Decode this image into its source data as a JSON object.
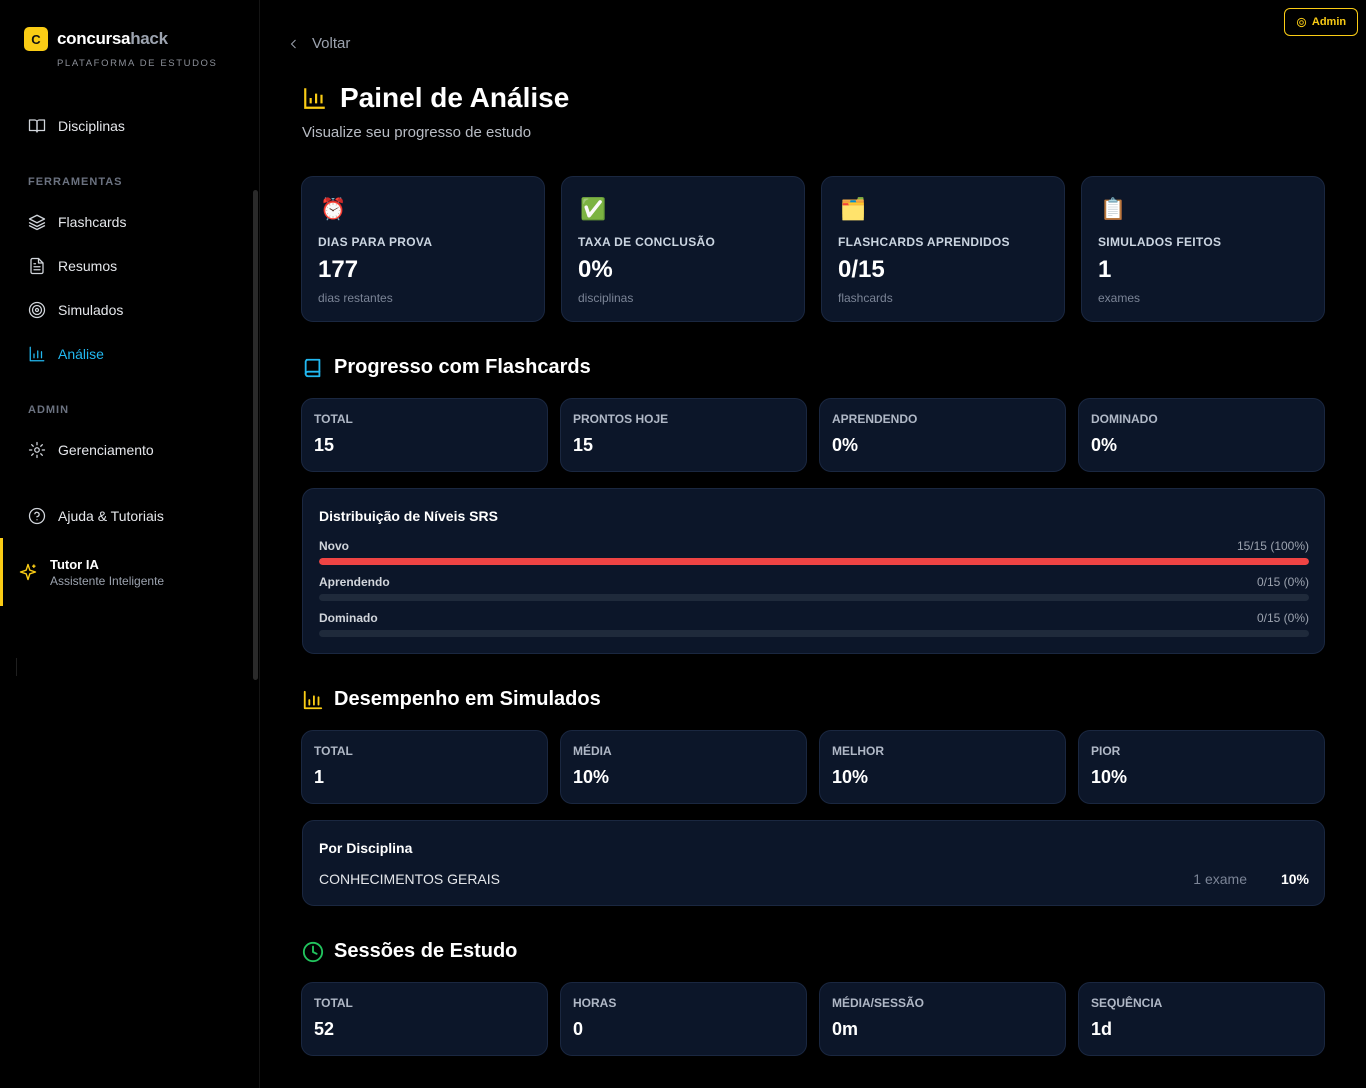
{
  "sidebar": {
    "logo_badge": "C",
    "logo_main": "concursa",
    "logo_accent": "hack",
    "logo_sub": "PLATAFORMA DE ESTUDOS",
    "disciplinas": "Disciplinas",
    "ferramentas_label": "FERRAMENTAS",
    "flashcards": "Flashcards",
    "resumos": "Resumos",
    "simulados": "Simulados",
    "analise": "Análise",
    "admin_label": "ADMIN",
    "gerenciamento": "Gerenciamento",
    "ajuda": "Ajuda & Tutoriais",
    "tutor_title": "Tutor IA",
    "tutor_sub": "Assistente Inteligente"
  },
  "header": {
    "admin_badge": "Admin",
    "back": "Voltar",
    "title": "Painel de Análise",
    "subtitle": "Visualize seu progresso de estudo"
  },
  "stats": [
    {
      "emoji": "⏰",
      "label": "DIAS PARA PROVA",
      "value": "177",
      "unit": "dias restantes"
    },
    {
      "emoji": "✅",
      "label": "TAXA DE CONCLUSÃO",
      "value": "0%",
      "unit": "disciplinas"
    },
    {
      "emoji": "🗂️",
      "label": "FLASHCARDS APRENDIDOS",
      "value": "0/15",
      "unit": "flashcards"
    },
    {
      "emoji": "📋",
      "label": "SIMULADOS FEITOS",
      "value": "1",
      "unit": "exames"
    }
  ],
  "flashcards": {
    "title": "Progresso com Flashcards",
    "cards": [
      {
        "label": "TOTAL",
        "value": "15"
      },
      {
        "label": "PRONTOS HOJE",
        "value": "15"
      },
      {
        "label": "APRENDENDO",
        "value": "0%"
      },
      {
        "label": "DOMINADO",
        "value": "0%"
      }
    ],
    "srs_title": "Distribuição de Níveis SRS",
    "levels": [
      {
        "name": "Novo",
        "count": "15/15 (100%)",
        "fraction": 1.0
      },
      {
        "name": "Aprendendo",
        "count": "0/15 (0%)",
        "fraction": 0
      },
      {
        "name": "Dominado",
        "count": "0/15 (0%)",
        "fraction": 0
      }
    ]
  },
  "simulados": {
    "title": "Desempenho em Simulados",
    "cards": [
      {
        "label": "TOTAL",
        "value": "1"
      },
      {
        "label": "MÉDIA",
        "value": "10%"
      },
      {
        "label": "MELHOR",
        "value": "10%"
      },
      {
        "label": "PIOR",
        "value": "10%"
      }
    ],
    "por_disciplina": "Por Disciplina",
    "disciplina_nome": "CONHECIMENTOS GERAIS",
    "disciplina_exames": "1 exame",
    "disciplina_pct": "10%"
  },
  "sessoes": {
    "title": "Sessões de Estudo",
    "cards": [
      {
        "label": "TOTAL",
        "value": "52"
      },
      {
        "label": "HORAS",
        "value": "0"
      },
      {
        "label": "MÉDIA/SESSÃO",
        "value": "0m"
      },
      {
        "label": "SEQUÊNCIA",
        "value": "1d"
      }
    ]
  },
  "colors": {
    "accent": "#facc15",
    "active_nav": "#22b8f0",
    "card_bg": "#0c1629",
    "bar_fill": "#ef4444"
  }
}
